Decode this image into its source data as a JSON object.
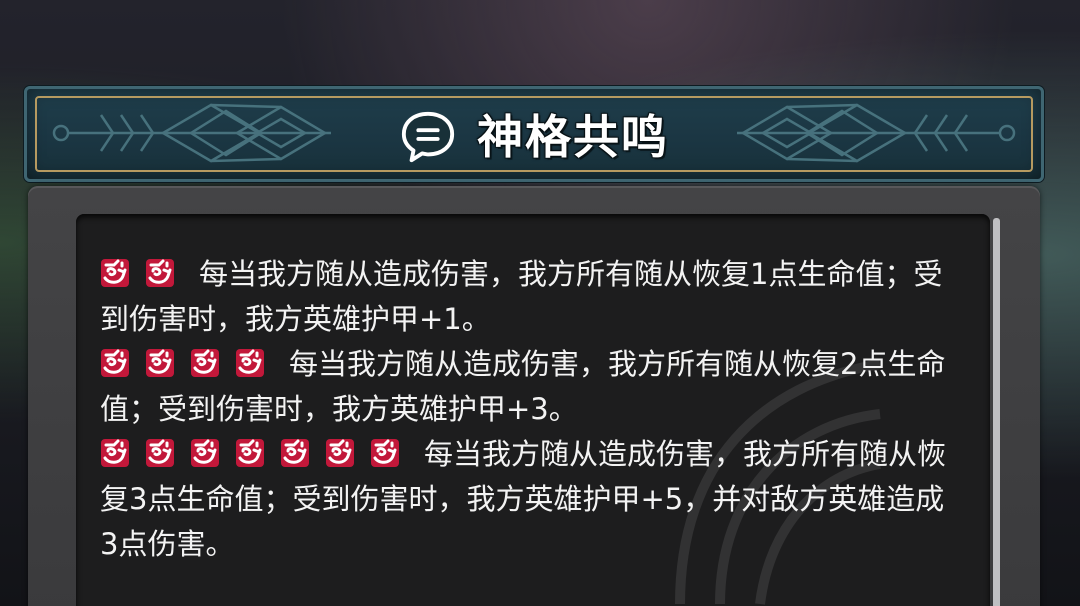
{
  "header": {
    "title": "神格共鸣",
    "icon": "speech-bubble-icon",
    "accent_color": "#b69a60",
    "banner_color": "#1f3e4b"
  },
  "panel": {
    "background_color": "#1d1d1e",
    "text_color": "#f3f3f3",
    "mark_icon": "deity-emblem-icon",
    "mark_color": "#c2183a",
    "tiers": [
      {
        "mark_count": 2,
        "text": "每当我方随从造成伤害，我方所有随从恢复1点生命值；受到伤害时，我方英雄护甲+1。"
      },
      {
        "mark_count": 4,
        "text": "每当我方随从造成伤害，我方所有随从恢复2点生命值；受到伤害时，我方英雄护甲+3。"
      },
      {
        "mark_count": 7,
        "text": "每当我方随从造成伤害，我方所有随从恢复3点生命值；受到伤害时，我方英雄护甲+5，并对敌方英雄造成3点伤害。"
      }
    ]
  }
}
